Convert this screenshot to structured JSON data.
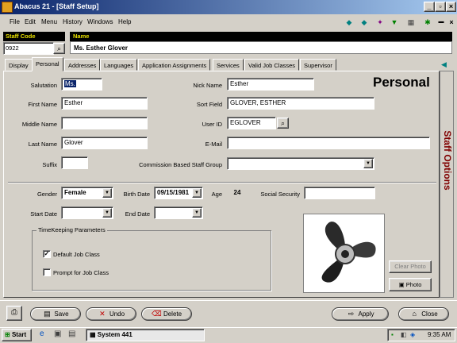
{
  "window": {
    "title": "Abacus 21 - [Staff Setup]"
  },
  "menu": [
    "File",
    "Edit",
    "Menu",
    "History",
    "Windows",
    "Help"
  ],
  "header": {
    "staff_code_label": "Staff Code",
    "staff_code_value": "0922",
    "name_label": "Name",
    "name_value": "Ms. Esther  Glover"
  },
  "tabs": [
    "Display",
    "Personal",
    "Addresses",
    "Languages",
    "Application Assignments",
    "Services",
    "Valid Job Classes",
    "Supervisor"
  ],
  "active_tab": "Personal",
  "section_title": "Personal",
  "side_panel_label": "Staff Options",
  "fields": {
    "salutation": {
      "label": "Salutation",
      "value": "Ms."
    },
    "first_name": {
      "label": "First Name",
      "value": "Esther"
    },
    "middle_name": {
      "label": "Middle Name",
      "value": ""
    },
    "last_name": {
      "label": "Last Name",
      "value": "Glover"
    },
    "suffix": {
      "label": "Suffix",
      "value": ""
    },
    "nick_name": {
      "label": "Nick Name",
      "value": "Esther"
    },
    "sort_field": {
      "label": "Sort Field",
      "value": "GLOVER, ESTHER"
    },
    "user_id": {
      "label": "User ID",
      "value": "EGLOVER"
    },
    "email": {
      "label": "E-Mail",
      "value": ""
    },
    "commission_group": {
      "label": "Commission Based Staff Group",
      "value": ""
    },
    "gender": {
      "label": "Gender",
      "value": "Female"
    },
    "birth_date": {
      "label": "Birth Date",
      "value": "09/15/1981"
    },
    "age": {
      "label": "Age",
      "value": "24"
    },
    "social_security": {
      "label": "Social Security",
      "value": ""
    },
    "start_date": {
      "label": "Start Date",
      "value": ""
    },
    "end_date": {
      "label": "End Date",
      "value": ""
    }
  },
  "timekeeping": {
    "legend": "TimeKeeping Parameters",
    "default_job_class": {
      "label": "Default Job Class",
      "checked": true
    },
    "prompt_job_class": {
      "label": "Prompt for Job Class",
      "checked": false
    }
  },
  "photo_buttons": {
    "clear": "Clear Photo",
    "photo": "Photo"
  },
  "bottom_buttons": {
    "save": "Save",
    "undo": "Undo",
    "delete": "Delete",
    "apply": "Apply",
    "close": "Close"
  },
  "taskbar": {
    "start": "Start",
    "task": "System 441",
    "clock": "9:35 AM"
  }
}
